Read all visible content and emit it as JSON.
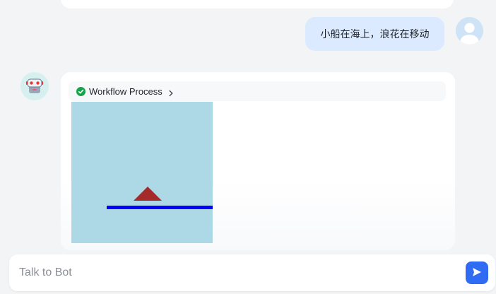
{
  "conversation": {
    "user_message": "小船在海上，浪花在移动",
    "bot_reply": {
      "workflow_label": "Workflow Process",
      "workflow_status": "completed",
      "scene": {
        "background_color": "#add8e6",
        "boat_color": "#a52a2a",
        "line_color": "#0000ff"
      }
    }
  },
  "icons": {
    "user_avatar": "user-avatar-icon",
    "bot_avatar": "robot-icon",
    "status": "check-circle-icon",
    "expand": "chevron-right-icon",
    "send": "send-icon"
  },
  "composer": {
    "placeholder": "Talk to Bot",
    "value": ""
  },
  "colors": {
    "accent": "#2f6bf3",
    "success": "#16a34a",
    "user_bubble": "#dbeafe"
  }
}
